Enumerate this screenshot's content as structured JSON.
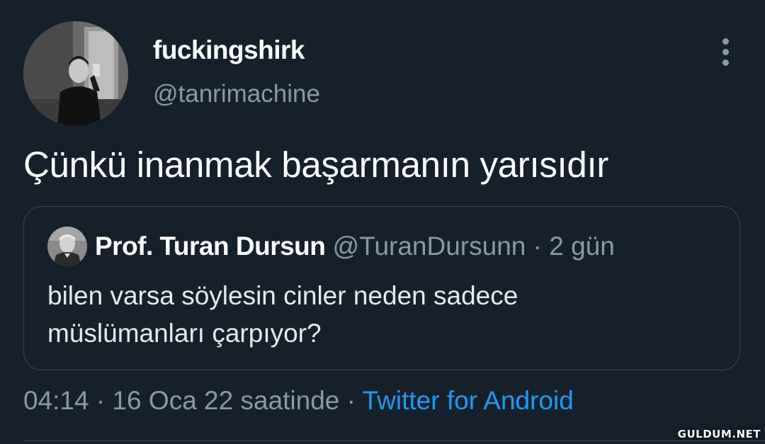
{
  "tweet": {
    "display_name": "fuckingshirk",
    "handle": "@tanrimachine",
    "text": "Çünkü inanmak başarmanın yarısıdır",
    "time": "04:14",
    "date": "16 Oca 22 saatinde",
    "separator": "·",
    "source": "Twitter for Android"
  },
  "quote": {
    "display_name": "Prof. Turan Dursun",
    "handle": "@TuranDursunn",
    "separator": "·",
    "time_ago": "2 gün",
    "text_line1": "bilen varsa söylesin cinler neden sadece",
    "text_line2": "müslümanları çarpıyor?"
  },
  "watermark": "GULDUM.NET",
  "colors": {
    "background": "#15202b",
    "primary_text": "#e7e9ea",
    "secondary_text": "#8b98a5",
    "link": "#1d9bf0",
    "border": "#38444d"
  },
  "icons": {
    "more": "more-vertical-icon"
  }
}
